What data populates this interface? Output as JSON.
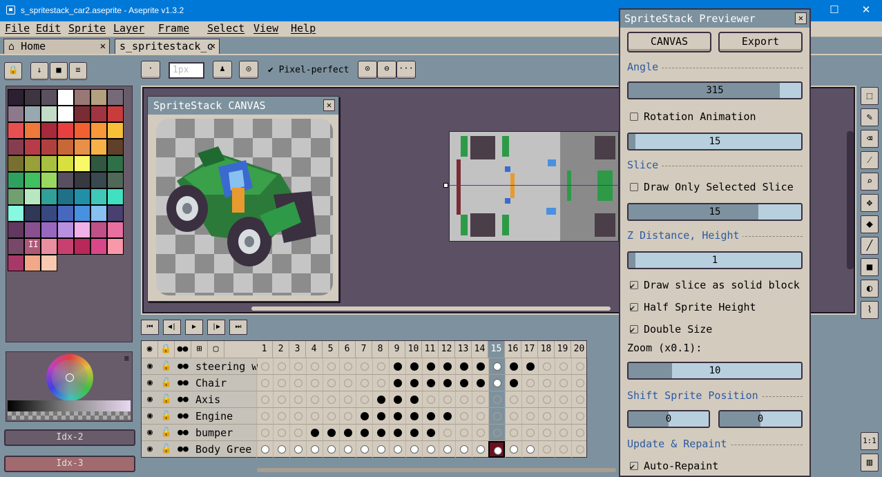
{
  "window": {
    "title": "s_spritestack_car2.aseprite - Aseprite v1.3.2",
    "minimize": "—",
    "maximize": "☐",
    "close": "✕"
  },
  "menu": [
    "File",
    "Edit",
    "Sprite",
    "Layer",
    "Frame",
    "Select",
    "View",
    "Help"
  ],
  "tabs": [
    {
      "label": "Home",
      "close": "✕"
    },
    {
      "label": "s_spritestack_c",
      "close": "✕"
    }
  ],
  "toolbar": {
    "size_placeholder": "1px",
    "pixel_perfect_label": "Pixel-perfect",
    "more": "···"
  },
  "left": {
    "palette_colors": [
      "#2c2030",
      "#3e3540",
      "#5b5060",
      "#ffffff",
      "#997775",
      "#b3a07e",
      "#766a78",
      "#8c7a8c",
      "#98a8b0",
      "#c2dac8",
      "#ffffff",
      "#7a2c34",
      "#a03440",
      "#c83c3c",
      "#e65050",
      "#f07838",
      "#a8283c",
      "#e84040",
      "#f06030",
      "#f89838",
      "#f8c038",
      "#883c50",
      "#b83c48",
      "#b04040",
      "#c86838",
      "#e89048",
      "#f8b048",
      "#604028",
      "#787030",
      "#98a038",
      "#a8c040",
      "#d8e040",
      "#f8f868",
      "#305840",
      "#307048",
      "#30a060",
      "#40c060",
      "#98d860",
      "#585060",
      "#383840",
      "#3a4850",
      "#506858",
      "#70a070",
      "#b8e8c0",
      "#30a098",
      "#207088",
      "#2090a8",
      "#40c8b8",
      "#40e0c0",
      "#88f8e0",
      "#303858",
      "#384880",
      "#4868c0",
      "#4890e0",
      "#88c0f0",
      "#484070",
      "#603860",
      "#885090",
      "#9868c0",
      "#b890e0",
      "#f0b0e8",
      "#c05088",
      "#e870a0",
      "#784868",
      "#b05878",
      "#e890a0",
      "#c84070",
      "#b82858",
      "#d84888",
      "#f898a8",
      "#a83868",
      "#f0a888",
      "#f8c8b0"
    ],
    "palette_extra": "II",
    "idx_primary": "Idx-2",
    "idx_secondary": "Idx-3"
  },
  "ss_canvas": {
    "title": "SpriteStack CANVAS",
    "close": "✕"
  },
  "playback": [
    "⏮",
    "◀|",
    "▶",
    "|▶",
    "⏭"
  ],
  "timeline": {
    "frames": [
      "1",
      "2",
      "3",
      "4",
      "5",
      "6",
      "7",
      "8",
      "9",
      "10",
      "11",
      "12",
      "13",
      "14",
      "15",
      "16",
      "17",
      "18",
      "19",
      "20"
    ],
    "current_frame": 15,
    "layers": [
      {
        "name": "steering w",
        "filled": [
          9,
          10,
          11,
          12,
          13,
          14,
          16,
          17
        ],
        "white": [
          15
        ]
      },
      {
        "name": "Chair",
        "filled": [
          9,
          10,
          11,
          12,
          13,
          14,
          16
        ],
        "white": [
          15
        ]
      },
      {
        "name": "Axis",
        "filled": [
          8,
          9,
          10
        ],
        "white": []
      },
      {
        "name": "Engine",
        "filled": [
          7,
          8,
          9,
          10,
          11,
          12
        ],
        "white": []
      },
      {
        "name": "bumper",
        "filled": [
          4,
          5,
          6,
          7,
          8,
          9,
          10,
          11
        ],
        "white": []
      },
      {
        "name": "Body Gree",
        "filled": [],
        "white": [
          1,
          2,
          3,
          4,
          5,
          6,
          7,
          8,
          9,
          10,
          11,
          12,
          13,
          14,
          15,
          16,
          17
        ]
      }
    ]
  },
  "previewer": {
    "title": "SpriteStack Previewer",
    "close": "✕",
    "canvas_button": "CANVAS",
    "export_button": "Export",
    "angle_section": "Angle",
    "angle_value": "315",
    "angle_fraction": 0.875,
    "rotation_animation": "Rotation Animation",
    "rotation_speed": "15",
    "rotation_speed_fraction": 0.04,
    "slice_section": "Slice",
    "draw_only_selected": "Draw Only Selected Slice",
    "slice_value": "15",
    "slice_fraction": 0.75,
    "z_section": "Z Distance, Height",
    "z_value": "1",
    "z_fraction": 0.04,
    "draw_solid": "Draw slice as solid block",
    "half_height": "Half Sprite Height",
    "double_size": "Double Size",
    "zoom_label": "Zoom (x0.1):",
    "zoom_value": "10",
    "zoom_fraction": 0.25,
    "shift_section": "Shift Sprite Position",
    "shift_x": "0",
    "shift_y": "0",
    "update_section": "Update & Repaint",
    "auto_repaint": "Auto-Repaint"
  },
  "right_tools_bottom": "1:1"
}
